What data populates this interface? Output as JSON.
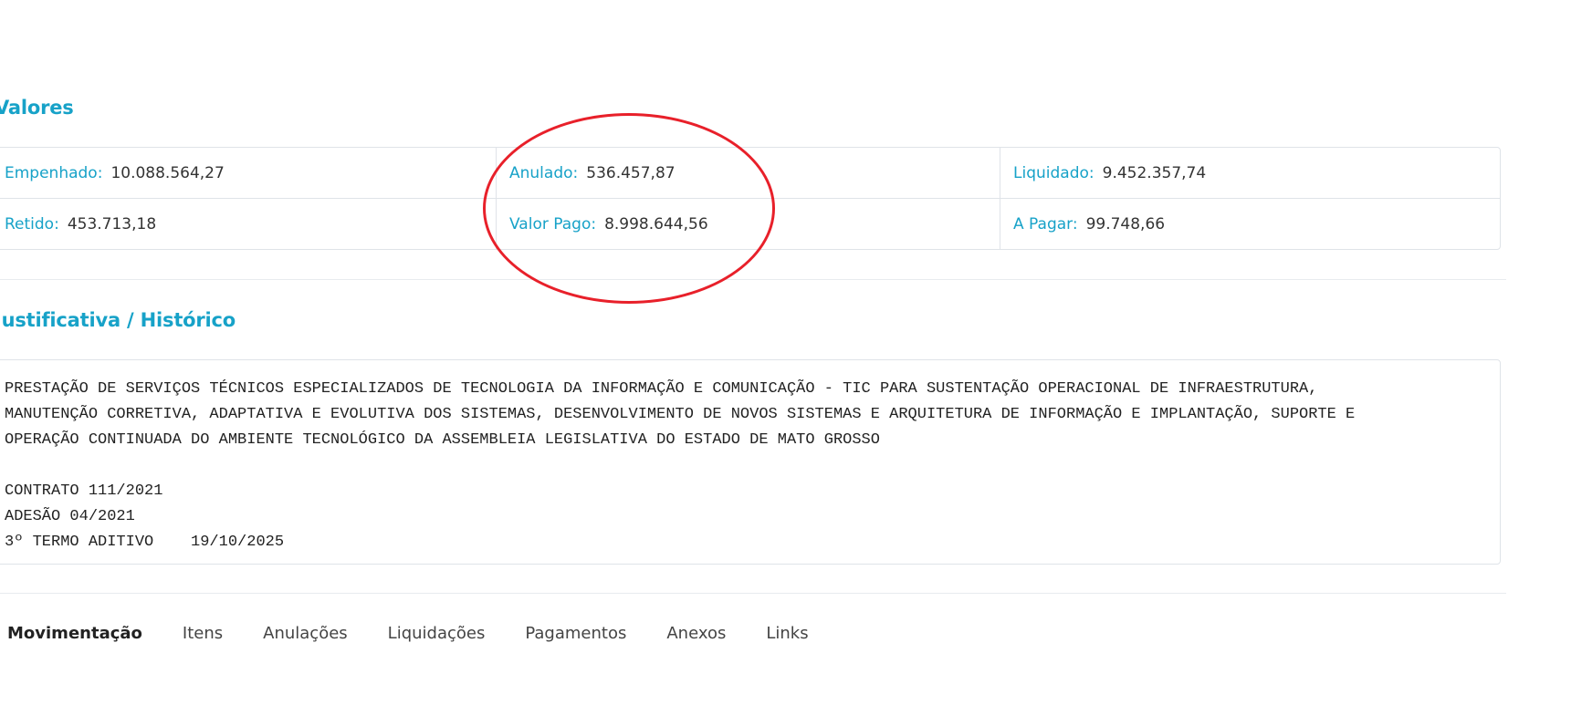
{
  "valores": {
    "title": "Valores",
    "row1": [
      {
        "label": "Empenhado:",
        "value": "10.088.564,27"
      },
      {
        "label": "Anulado:",
        "value": "536.457,87"
      },
      {
        "label": "Liquidado:",
        "value": "9.452.357,74"
      }
    ],
    "row2": [
      {
        "label": "Retido:",
        "value": "453.713,18"
      },
      {
        "label": "Valor Pago:",
        "value": "8.998.644,56"
      },
      {
        "label": "A Pagar:",
        "value": "99.748,66"
      }
    ]
  },
  "historico": {
    "title": "Justificativa / Histórico",
    "text": "PRESTAÇÃO DE SERVIÇOS TÉCNICOS ESPECIALIZADOS DE TECNOLOGIA DA INFORMAÇÃO E COMUNICAÇÃO - TIC PARA SUSTENTAÇÃO OPERACIONAL DE INFRAESTRUTURA,\nMANUTENÇÃO CORRETIVA, ADAPTATIVA E EVOLUTIVA DOS SISTEMAS, DESENVOLVIMENTO DE NOVOS SISTEMAS E ARQUITETURA DE INFORMAÇÃO E IMPLANTAÇÃO, SUPORTE E\nOPERAÇÃO CONTINUADA DO AMBIENTE TECNOLÓGICO DA ASSEMBLEIA LEGISLATIVA DO ESTADO DE MATO GROSSO\n\nCONTRATO 111/2021\nADESÃO 04/2021\n3º TERMO ADITIVO    19/10/2025"
  },
  "tabs": [
    {
      "label": "Movimentação"
    },
    {
      "label": "Itens"
    },
    {
      "label": "Anulações"
    },
    {
      "label": "Liquidações"
    },
    {
      "label": "Pagamentos"
    },
    {
      "label": "Anexos"
    },
    {
      "label": "Links"
    }
  ],
  "colors": {
    "accent": "#17a2c8",
    "annotation": "#e8202a",
    "border": "#dfe3e8"
  }
}
